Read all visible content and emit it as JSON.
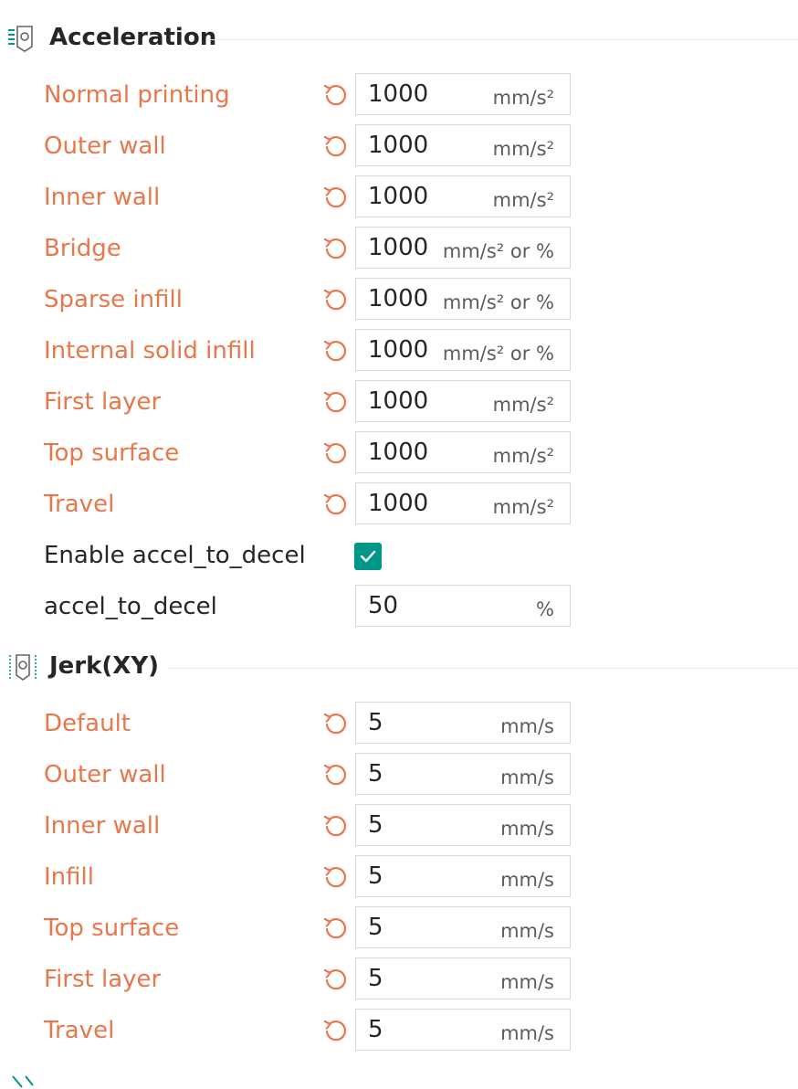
{
  "acceleration": {
    "title": "Acceleration",
    "icon": "acceleration-settings-icon",
    "rows": [
      {
        "label": "Normal printing",
        "value": "1000",
        "unit": "mm/s²",
        "modified": true
      },
      {
        "label": "Outer wall",
        "value": "1000",
        "unit": "mm/s²",
        "modified": true
      },
      {
        "label": "Inner wall",
        "value": "1000",
        "unit": "mm/s²",
        "modified": true
      },
      {
        "label": "Bridge",
        "value": "1000",
        "unit": "mm/s² or %",
        "modified": true
      },
      {
        "label": "Sparse infill",
        "value": "1000",
        "unit": "mm/s² or %",
        "modified": true
      },
      {
        "label": "Internal solid infill",
        "value": "1000",
        "unit": "mm/s² or %",
        "modified": true
      },
      {
        "label": "First layer",
        "value": "1000",
        "unit": "mm/s²",
        "modified": true
      },
      {
        "label": "Top surface",
        "value": "1000",
        "unit": "mm/s²",
        "modified": true
      },
      {
        "label": "Travel",
        "value": "1000",
        "unit": "mm/s²",
        "modified": true
      }
    ],
    "enable_accel_to_decel": {
      "label": "Enable accel_to_decel",
      "checked": true
    },
    "accel_to_decel": {
      "label": "accel_to_decel",
      "value": "50",
      "unit": "%"
    }
  },
  "jerk": {
    "title": "Jerk(XY)",
    "icon": "jerk-settings-icon",
    "rows": [
      {
        "label": "Default",
        "value": "5",
        "unit": "mm/s",
        "modified": true
      },
      {
        "label": "Outer wall",
        "value": "5",
        "unit": "mm/s",
        "modified": true
      },
      {
        "label": "Inner wall",
        "value": "5",
        "unit": "mm/s",
        "modified": true
      },
      {
        "label": "Infill",
        "value": "5",
        "unit": "mm/s",
        "modified": true
      },
      {
        "label": "Top surface",
        "value": "5",
        "unit": "mm/s",
        "modified": true
      },
      {
        "label": "First layer",
        "value": "5",
        "unit": "mm/s",
        "modified": true
      },
      {
        "label": "Travel",
        "value": "5",
        "unit": "mm/s",
        "modified": true
      }
    ]
  },
  "colors": {
    "modified_label": "#e8774a",
    "checkbox": "#009688",
    "text": "#262626",
    "unit": "#5c5c5c",
    "border": "#d9d9d9"
  }
}
